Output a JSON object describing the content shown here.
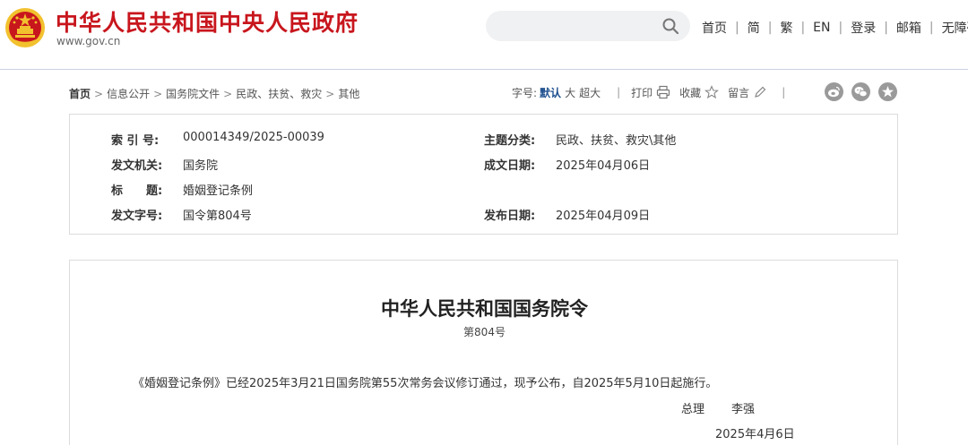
{
  "header": {
    "site_title": "中华人民共和国中央人民政府",
    "site_domain": "www.gov.cn",
    "search_placeholder": "",
    "nav": [
      {
        "label": "首页"
      },
      {
        "label": "简"
      },
      {
        "label": "繁"
      },
      {
        "label": "EN"
      },
      {
        "label": "登录"
      },
      {
        "label": "邮箱"
      },
      {
        "label": "无障碍"
      }
    ],
    "nav_separator": "|"
  },
  "breadcrumb": {
    "items": [
      "首页",
      "信息公开",
      "国务院文件",
      "民政、扶贫、救灾",
      "其他"
    ],
    "separator": ">"
  },
  "tools": {
    "font_size_label": "字号:",
    "font_default": "默认",
    "font_large": "大",
    "font_xlarge": "超大",
    "separator": "|",
    "print_label": "打印",
    "favorite_label": "收藏",
    "comment_label": "留言",
    "share_icons": [
      "weibo-icon",
      "wechat-icon",
      "favorite-star-icon"
    ]
  },
  "meta": {
    "index_label": "索 引 号:",
    "index_value": "000014349/2025-00039",
    "topic_label": "主题分类:",
    "topic_value": "民政、扶贫、救灾\\其他",
    "issuer_label": "发文机关:",
    "issuer_value": "国务院",
    "written_date_label": "成文日期:",
    "written_date_value": "2025年04月06日",
    "title_label": "标　　题:",
    "title_value": "婚姻登记条例",
    "doc_number_label": "发文字号:",
    "doc_number_value": "国令第804号",
    "publish_date_label": "发布日期:",
    "publish_date_value": "2025年04月09日"
  },
  "document": {
    "title": "中华人民共和国国务院令",
    "number": "第804号",
    "body": "《婚姻登记条例》已经2025年3月21日国务院第55次常务会议修订通过，现予公布，自2025年5月10日起施行。",
    "signer_title": "总理",
    "signer_name": "李强",
    "sign_date": "2025年4月6日"
  },
  "colors": {
    "brand_red": "#c8161d",
    "accent_blue": "#1d4f8e",
    "emblem_gold": "#f2c12e"
  }
}
